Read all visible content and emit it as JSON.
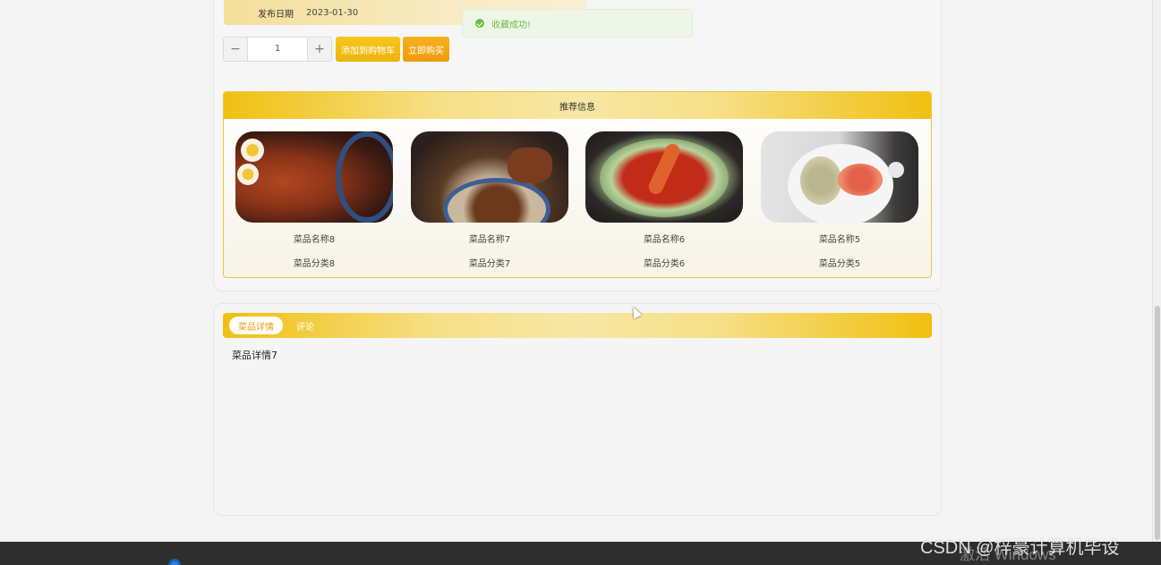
{
  "product": {
    "date_label": "发布日期",
    "date_value": "2023-01-30",
    "quantity": "1",
    "minus_symbol": "−",
    "plus_symbol": "+",
    "add_to_cart_label": "添加到购物车",
    "buy_now_label": "立即购买"
  },
  "toast": {
    "message": "收藏成功!",
    "icon": "check-circle-icon",
    "color": "#67c23a"
  },
  "recommend": {
    "title": "推荐信息",
    "items": [
      {
        "name": "菜品名称8",
        "category": "菜品分类8",
        "image": "braised-pork-egg-bowl"
      },
      {
        "name": "菜品名称7",
        "category": "菜品分类7",
        "image": "braised-meat-plate"
      },
      {
        "name": "菜品名称6",
        "category": "菜品分类6",
        "image": "crayfish-chili-plate"
      },
      {
        "name": "菜品名称5",
        "category": "菜品分类5",
        "image": "shrimp-rice-plate"
      }
    ]
  },
  "tabs": {
    "items": [
      {
        "label": "菜品详情",
        "active": true
      },
      {
        "label": "评论",
        "active": false
      }
    ],
    "content": "菜品详情7"
  },
  "colors": {
    "accent": "#f0c010",
    "buy": "#ef9a0b"
  },
  "watermarks": {
    "csdn": "CSDN @梓豪计算机毕设",
    "windows": "激活 Windows"
  }
}
